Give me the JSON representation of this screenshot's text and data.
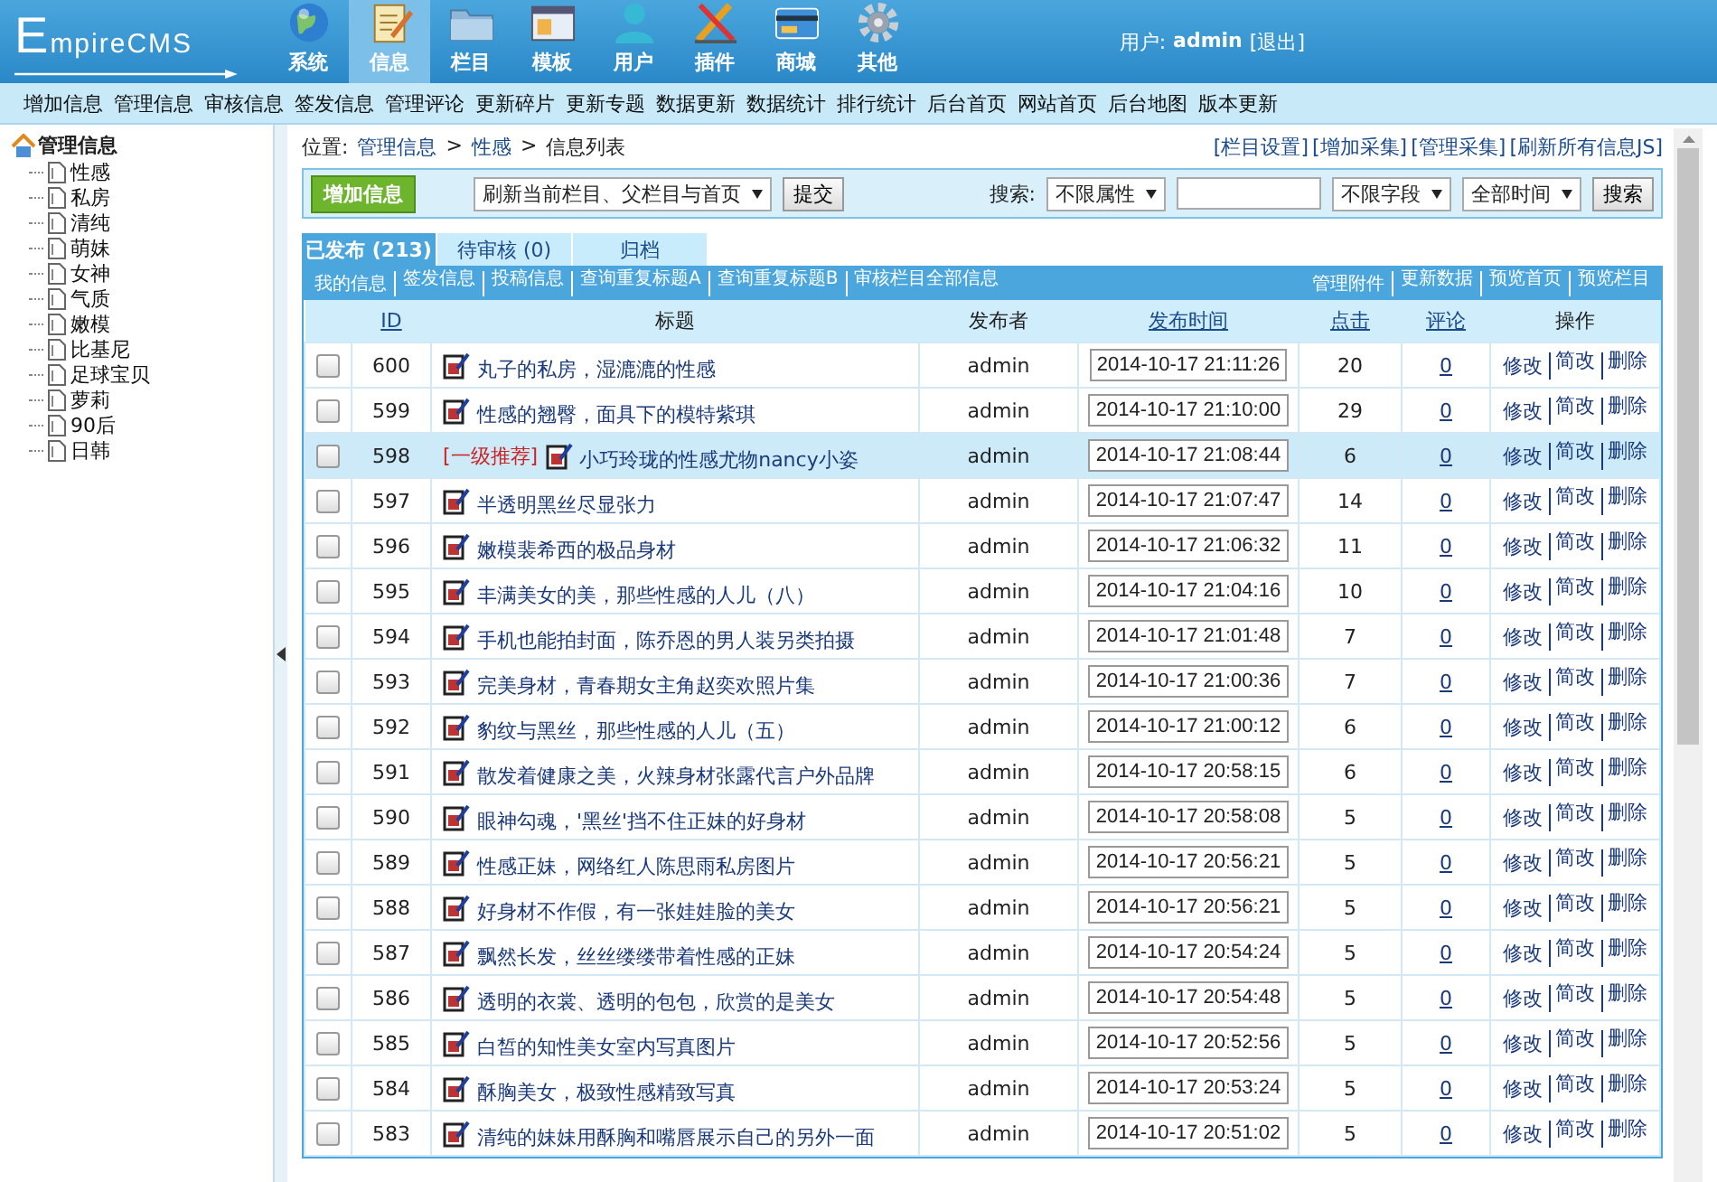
{
  "header": {
    "logo": "EmpireCMS",
    "nav": [
      {
        "label": "系统",
        "kind": "globe",
        "selected": false
      },
      {
        "label": "信息",
        "kind": "notepad",
        "selected": true
      },
      {
        "label": "栏目",
        "kind": "folder",
        "selected": false
      },
      {
        "label": "模板",
        "kind": "window",
        "selected": false
      },
      {
        "label": "用户",
        "kind": "person",
        "selected": false
      },
      {
        "label": "插件",
        "kind": "tools",
        "selected": false
      },
      {
        "label": "商城",
        "kind": "card",
        "selected": false
      },
      {
        "label": "其他",
        "kind": "gear",
        "selected": false
      }
    ],
    "user_label": "用户:",
    "username": "admin",
    "logout": "[退出]"
  },
  "menu": [
    "增加信息",
    "管理信息",
    "审核信息",
    "签发信息",
    "管理评论",
    "更新碎片",
    "更新专题",
    "数据更新",
    "数据统计",
    "排行统计",
    "后台首页",
    "网站首页",
    "后台地图",
    "版本更新"
  ],
  "sidebar": {
    "root": "管理信息",
    "children": [
      "性感",
      "私房",
      "清纯",
      "萌妹",
      "女神",
      "气质",
      "嫩模",
      "比基尼",
      "足球宝贝",
      "萝莉",
      "90后",
      "日韩"
    ]
  },
  "breadcrumb": [
    {
      "kind": "label",
      "text": "位置:"
    },
    {
      "kind": "link",
      "text": "管理信息"
    },
    {
      "kind": "sep",
      "text": ">"
    },
    {
      "kind": "link",
      "text": "性感"
    },
    {
      "kind": "sep",
      "text": ">"
    },
    {
      "kind": "text",
      "text": "信息列表"
    }
  ],
  "top_links": [
    "[栏目设置]",
    "[增加采集]",
    "[管理采集]",
    "[刷新所有信息JS]"
  ],
  "toolbar": {
    "add_button": "增加信息",
    "refresh_select": "刷新当前栏目、父栏目与首页",
    "submit": "提交",
    "search_label": "搜索:",
    "attr_select": "不限属性",
    "field_select": "不限字段",
    "time_select": "全部时间",
    "search_button": "搜索"
  },
  "tabs": [
    {
      "label": "已发布 (213)",
      "selected": true
    },
    {
      "label": "待审核 (0)",
      "selected": false
    },
    {
      "label": "归档",
      "selected": false
    }
  ],
  "links_left": [
    "我的信息",
    "签发信息",
    "投稿信息",
    "查询重复标题A",
    "查询重复标题B",
    "审核栏目全部信息"
  ],
  "links_right": [
    "管理附件",
    "更新数据",
    "预览首页",
    "预览栏目"
  ],
  "table": {
    "columns": [
      {
        "label": "ID",
        "link": true
      },
      {
        "label": "标题",
        "link": false
      },
      {
        "label": "发布者",
        "link": false
      },
      {
        "label": "发布时间",
        "link": true
      },
      {
        "label": "点击",
        "link": true
      },
      {
        "label": "评论",
        "link": true
      },
      {
        "label": "操作",
        "link": false
      }
    ],
    "rows": [
      {
        "id": "600",
        "title": "丸子的私房，湿漉漉的性感",
        "publisher": "admin",
        "time": "2014-10-17 21:11:26",
        "clicks": "20",
        "comments": "0",
        "checked": false,
        "selected": false,
        "actions": [
          "修改",
          "简改",
          "删除"
        ]
      },
      {
        "id": "599",
        "title": "性感的翘臀，面具下的模特紫琪",
        "publisher": "admin",
        "time": "2014-10-17 21:10:00",
        "clicks": "29",
        "comments": "0",
        "checked": false,
        "selected": false,
        "actions": [
          "修改",
          "简改",
          "删除"
        ]
      },
      {
        "id": "598",
        "recommend": "[一级推荐]",
        "title": "小巧玲珑的性感尤物nancy小姿",
        "publisher": "admin",
        "time": "2014-10-17 21:08:44",
        "clicks": "6",
        "comments": "0",
        "checked": false,
        "selected": true,
        "actions": [
          "修改",
          "简改",
          "删除"
        ]
      },
      {
        "id": "597",
        "title": "半透明黑丝尽显张力",
        "publisher": "admin",
        "time": "2014-10-17 21:07:47",
        "clicks": "14",
        "comments": "0",
        "checked": false,
        "selected": false,
        "actions": [
          "修改",
          "简改",
          "删除"
        ]
      },
      {
        "id": "596",
        "title": "嫩模裴希西的极品身材",
        "publisher": "admin",
        "time": "2014-10-17 21:06:32",
        "clicks": "11",
        "comments": "0",
        "checked": false,
        "selected": false,
        "actions": [
          "修改",
          "简改",
          "删除"
        ]
      },
      {
        "id": "595",
        "title": "丰满美女的美，那些性感的人儿（八）",
        "publisher": "admin",
        "time": "2014-10-17 21:04:16",
        "clicks": "10",
        "comments": "0",
        "checked": false,
        "selected": false,
        "actions": [
          "修改",
          "简改",
          "删除"
        ]
      },
      {
        "id": "594",
        "title": "手机也能拍封面，陈乔恩的男人装另类拍摄",
        "publisher": "admin",
        "time": "2014-10-17 21:01:48",
        "clicks": "7",
        "comments": "0",
        "checked": false,
        "selected": false,
        "actions": [
          "修改",
          "简改",
          "删除"
        ]
      },
      {
        "id": "593",
        "title": "完美身材，青春期女主角赵奕欢照片集",
        "publisher": "admin",
        "time": "2014-10-17 21:00:36",
        "clicks": "7",
        "comments": "0",
        "checked": false,
        "selected": false,
        "actions": [
          "修改",
          "简改",
          "删除"
        ]
      },
      {
        "id": "592",
        "title": "豹纹与黑丝，那些性感的人儿（五）",
        "publisher": "admin",
        "time": "2014-10-17 21:00:12",
        "clicks": "6",
        "comments": "0",
        "checked": false,
        "selected": false,
        "actions": [
          "修改",
          "简改",
          "删除"
        ]
      },
      {
        "id": "591",
        "title": "散发着健康之美，火辣身材张露代言户外品牌",
        "publisher": "admin",
        "time": "2014-10-17 20:58:15",
        "clicks": "6",
        "comments": "0",
        "checked": false,
        "selected": false,
        "actions": [
          "修改",
          "简改",
          "删除"
        ]
      },
      {
        "id": "590",
        "title": "眼神勾魂，'黑丝'挡不住正妹的好身材",
        "publisher": "admin",
        "time": "2014-10-17 20:58:08",
        "clicks": "5",
        "comments": "0",
        "checked": false,
        "selected": false,
        "actions": [
          "修改",
          "简改",
          "删除"
        ]
      },
      {
        "id": "589",
        "title": "性感正妹，网络红人陈思雨私房图片",
        "publisher": "admin",
        "time": "2014-10-17 20:56:21",
        "clicks": "5",
        "comments": "0",
        "checked": false,
        "selected": false,
        "actions": [
          "修改",
          "简改",
          "删除"
        ]
      },
      {
        "id": "588",
        "title": "好身材不作假，有一张娃娃脸的美女",
        "publisher": "admin",
        "time": "2014-10-17 20:56:21",
        "clicks": "5",
        "comments": "0",
        "checked": false,
        "selected": false,
        "actions": [
          "修改",
          "简改",
          "删除"
        ]
      },
      {
        "id": "587",
        "title": "飘然长发，丝丝缕缕带着性感的正妹",
        "publisher": "admin",
        "time": "2014-10-17 20:54:24",
        "clicks": "5",
        "comments": "0",
        "checked": false,
        "selected": false,
        "actions": [
          "修改",
          "简改",
          "删除"
        ]
      },
      {
        "id": "586",
        "title": "透明的衣裳、透明的包包，欣赏的是美女",
        "publisher": "admin",
        "time": "2014-10-17 20:54:48",
        "clicks": "5",
        "comments": "0",
        "checked": false,
        "selected": false,
        "actions": [
          "修改",
          "简改",
          "删除"
        ]
      },
      {
        "id": "585",
        "title": "白皙的知性美女室内写真图片",
        "publisher": "admin",
        "time": "2014-10-17 20:52:56",
        "clicks": "5",
        "comments": "0",
        "checked": false,
        "selected": false,
        "actions": [
          "修改",
          "简改",
          "删除"
        ]
      },
      {
        "id": "584",
        "title": "酥胸美女，极致性感精致写真",
        "publisher": "admin",
        "time": "2014-10-17 20:53:24",
        "clicks": "5",
        "comments": "0",
        "checked": false,
        "selected": false,
        "actions": [
          "修改",
          "简改",
          "删除"
        ]
      },
      {
        "id": "583",
        "title": "清纯的妹妹用酥胸和嘴唇展示自己的另外一面",
        "publisher": "admin",
        "time": "2014-10-17 20:51:02",
        "clicks": "5",
        "comments": "0",
        "checked": false,
        "selected": false,
        "actions": [
          "修改",
          "简改",
          "删除"
        ]
      }
    ]
  }
}
